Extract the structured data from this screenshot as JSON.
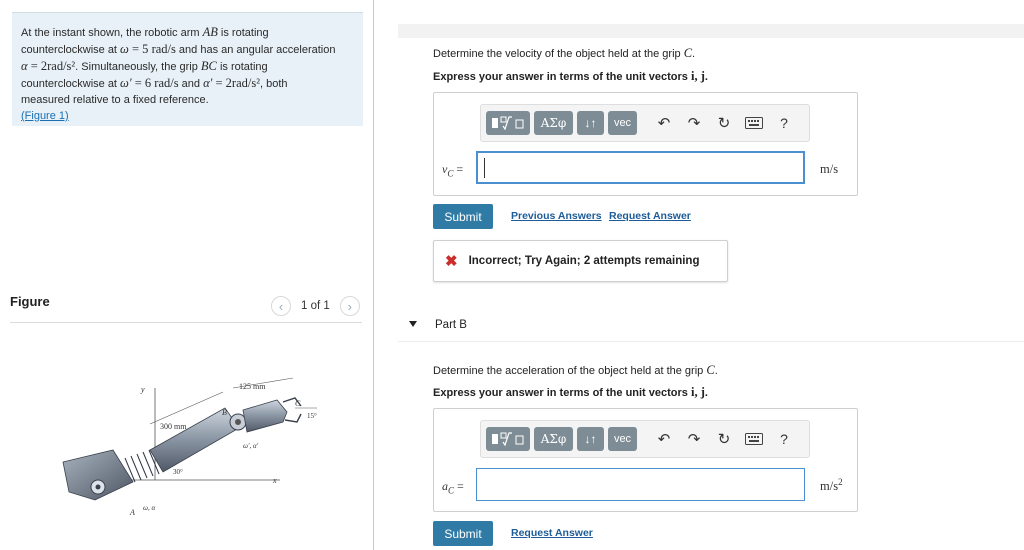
{
  "problem": {
    "p1": "At the instant shown, the robotic arm ",
    "p2": "AB",
    "p3": " is rotating",
    "p4": "counterclockwise at ",
    "p5": "ω",
    "p6": " = 5 ",
    "p7": "rad/s",
    "p8": " and has an angular acceleration",
    "p9": "α",
    "p10": " = 2rad/s²",
    "p11": ". Simultaneously, the grip ",
    "p12": "BC",
    "p13": " is rotating",
    "p14": "counterclockwise at ",
    "p15": "ω′",
    "p16": " = 6 rad/s",
    "p17": " and ",
    "p18": "α′",
    "p19": " = 2rad/s²",
    "p20": ", both",
    "p21": "measured relative to a fixed reference.",
    "figure_link": "(Figure 1)"
  },
  "figure": {
    "heading": "Figure",
    "page_indicator": "1 of 1",
    "labels": {
      "dim_125": "125 mm",
      "dim_300": "300 mm",
      "angle_15": "15°",
      "angle_30": "30°",
      "point_a": "A",
      "point_b": "B",
      "point_c": "C",
      "axis_x": "x",
      "axis_y": "y",
      "omega_alpha": "ω, α",
      "omega_alpha_prime": "ω′, α′"
    }
  },
  "part_a": {
    "prompt_text": "Determine the velocity of the object held at the grip ",
    "prompt_var": "C",
    "prompt_end": ".",
    "express_text": "Express your answer in terms of the unit vectors ",
    "express_vectors": "i, j",
    "express_end": ".",
    "var_label": "v",
    "var_sub": "C",
    "equals": " =",
    "input_value": "",
    "unit": "m/s",
    "submit_label": "Submit",
    "previous_answers_label": "Previous Answers",
    "request_answer_label": "Request Answer",
    "feedback": "Incorrect; Try Again; 2 attempts remaining"
  },
  "part_b": {
    "title": "Part B",
    "prompt_text": "Determine the acceleration of the object held at the grip ",
    "prompt_var": "C",
    "prompt_end": ".",
    "express_text": "Express your answer in terms of the unit vectors ",
    "express_vectors": "i, j",
    "express_end": ".",
    "var_label": "a",
    "var_sub": "C",
    "equals": " =",
    "input_value": "",
    "unit_base": "m/s",
    "unit_exp": "2",
    "submit_label": "Submit",
    "request_answer_label": "Request Answer"
  },
  "toolbar": {
    "greek_label": "ΑΣφ",
    "arrows_label": "↓↑",
    "vec_label": "vec",
    "help_label": "?",
    "icons": [
      "templates-icon",
      "greek-icon",
      "subscript-icon",
      "vec-icon",
      "undo-icon",
      "redo-icon",
      "reset-icon",
      "keyboard-icon",
      "help-icon"
    ]
  },
  "colors": {
    "problem_bg": "#e8f1f7",
    "link": "#1a6fb3",
    "submit_bg": "#2f7ba6",
    "toolbar_btn": "#7d8c95",
    "input_border": "#4a8fd0",
    "error": "#c9302c"
  }
}
